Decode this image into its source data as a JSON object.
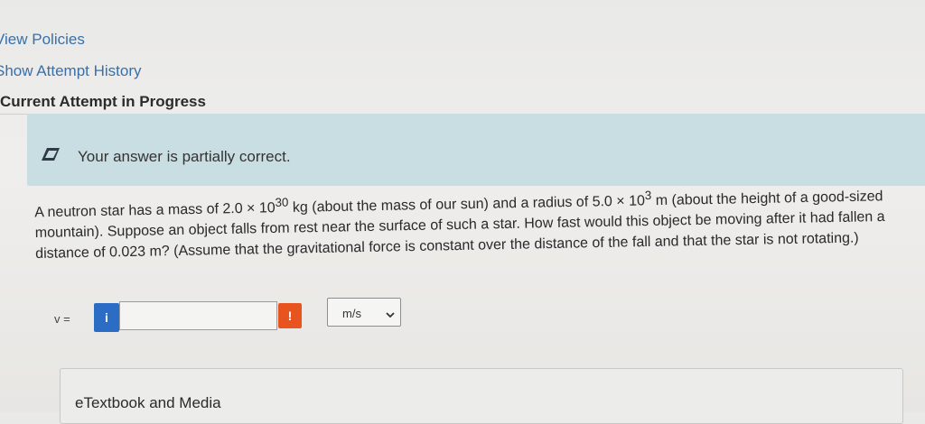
{
  "links": {
    "view_policies": "View Policies",
    "show_attempt_history": "Show Attempt History"
  },
  "attempt": {
    "current_label": "Current Attempt in Progress"
  },
  "feedback": {
    "message": "Your answer is partially correct.",
    "icon": "pencil-icon"
  },
  "question": {
    "part1": "A neutron star has a mass of 2.0 × 10",
    "exp1": "30",
    "part2": " kg (about the mass of our sun) and a radius of 5.0 × 10",
    "exp2": "3",
    "part3": " m (about the height of a good-sized mountain). Suppose an object falls from rest near the surface of such a star. How fast would this object be moving after it had fallen a distance of 0.023 m? (Assume that the gravitational force is constant over the distance of the fall and that the star is not rotating.)"
  },
  "answer": {
    "variable_label": "v =",
    "info_glyph": "i",
    "value": "",
    "warning_glyph": "!",
    "unit_selected": "m/s"
  },
  "resources": {
    "etextbook_label": "eTextbook and Media"
  },
  "colors": {
    "link": "#3a6fa8",
    "banner": "#c9dee3",
    "info": "#2b6cc4",
    "warning": "#e8541f"
  }
}
